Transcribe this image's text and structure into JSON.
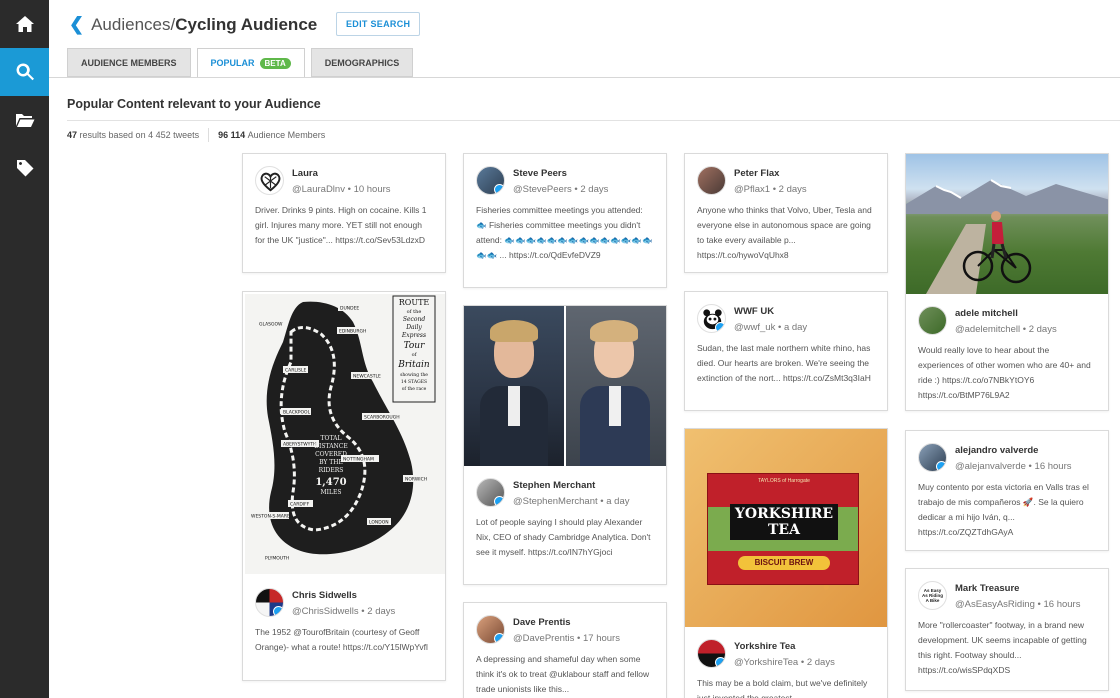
{
  "sidebar": {
    "items": [
      {
        "icon": "home-icon"
      },
      {
        "icon": "search-icon",
        "active": true
      },
      {
        "icon": "folder-icon"
      },
      {
        "icon": "tag-icon"
      }
    ]
  },
  "header": {
    "breadcrumb_parent": "Audiences",
    "breadcrumb_separator": "/",
    "breadcrumb_current": "Cycling Audience",
    "edit_search_label": "EDIT SEARCH"
  },
  "tabs": [
    {
      "label": "AUDIENCE MEMBERS"
    },
    {
      "label": "POPULAR",
      "badge": "BETA",
      "active": true
    },
    {
      "label": "DEMOGRAPHICS"
    }
  ],
  "section": {
    "title": "Popular Content relevant to your Audience",
    "results_count": "47",
    "results_text": "results based on 4 452 tweets",
    "members_count": "96 114",
    "members_text": "Audience Members"
  },
  "cards": {
    "laura": {
      "name": "Laura",
      "handle": "@LauraDlnv",
      "time": "10 hours",
      "text": "Driver. Drinks 9 pints. High on cocaine. Kills 1 girl. Injures many more. YET still not enough for the UK \"justice\"... https://t.co/Sev53LdzxD"
    },
    "steve": {
      "name": "Steve Peers",
      "handle": "@StevePeers",
      "time": "2 days",
      "text": "Fisheries committee meetings you attended: 🐟 Fisheries committee meetings you didn't attend: 🐟🐟🐟🐟🐟🐟🐟🐟🐟🐟🐟🐟🐟🐟🐟🐟 ... https://t.co/QdEvfeDVZ9"
    },
    "peter": {
      "name": "Peter Flax",
      "handle": "@Pflax1",
      "time": "2 days",
      "text": "Anyone who thinks that Volvo, Uber, Tesla and everyone else in autonomous space are going to take every available p... https://t.co/hywoVqUhx8"
    },
    "adele": {
      "name": "adele mitchell",
      "handle": "@adelemitchell",
      "time": "2 days",
      "text": "Would really love to hear about the experiences of other women who are 40+ and ride :) https://t.co/o7NBkYtOY6 https://t.co/BtMP76L9A2"
    },
    "wwf": {
      "name": "WWF UK",
      "handle": "@wwf_uk",
      "time": "a day",
      "text": "Sudan, the last male northern white rhino, has died. Our hearts are broken. We're seeing the extinction of the nort... https://t.co/ZsMt3q3IaH"
    },
    "stephen": {
      "name": "Stephen Merchant",
      "handle": "@StephenMerchant",
      "time": "a day",
      "text": "Lot of people saying I should play Alexander Nix, CEO of shady Cambridge Analytica. Don't see it myself. https://t.co/IN7hYGjoci"
    },
    "chris": {
      "name": "Chris Sidwells",
      "handle": "@ChrisSidwells",
      "time": "2 days",
      "text": "The 1952 @TourofBritain (courtesy of Geoff Orange)- what a route! https://t.co/Y15lWpYvfl"
    },
    "alejandro": {
      "name": "alejandro valverde",
      "handle": "@alejanvalverde",
      "time": "16 hours",
      "text": "Muy contento por esta victoria en Valls tras el trabajo de mis compañeros 🚀. Se la quiero dedicar a mi hijo Iván, q... https://t.co/ZQZTdhGAyA"
    },
    "yorkshire": {
      "name": "Yorkshire Tea",
      "handle": "@YorkshireTea",
      "time": "2 days",
      "text": "This may be a bold claim, but we've definitely just invented the greatest..."
    },
    "dave": {
      "name": "Dave Prentis",
      "handle": "@DavePrentis",
      "time": "17 hours",
      "text": "A depressing and shameful day when some think it's ok to treat @uklabour staff and fellow trade unionists like this..."
    },
    "mark": {
      "name": "Mark Treasure",
      "handle": "@AsEasyAsRiding",
      "time": "16 hours",
      "text": "More \"rollercoaster\" footway, in a brand new development. UK seems incapable of getting this right. Footway should... https://t.co/wisSPdqXDS"
    }
  },
  "map_text": {
    "title_lines": [
      "ROUTE",
      "of the",
      "Second",
      "Daily",
      "Express",
      "Tour",
      "of",
      "Britain",
      "showing the",
      "14 STAGES",
      "of the race"
    ],
    "towns": [
      "DUNDEE",
      "GLASGOW",
      "EDINBURGH",
      "CARLISLE",
      "NEWCASTLE",
      "BLACKPOOL",
      "SCARBOROUGH",
      "ABERYSTWYTH",
      "NOTTINGHAM",
      "NORWICH",
      "CARDIFF",
      "LONDON",
      "WESTON-S-MARE",
      "PLYMOUTH"
    ],
    "distance_lines": [
      "TOTAL",
      "DISTANCE",
      "COVERED",
      "BY THE",
      "RIDERS",
      "1,470",
      "MILES"
    ]
  },
  "product_text": {
    "brand_top": "TAYLORS of Harrogate",
    "brand": "YORKSHIRE",
    "brand2": "TEA",
    "ribbon": "BISCUIT BREW"
  },
  "avatar_text": {
    "mark": "As Easy As Riding A Bike"
  },
  "colors": {
    "accent": "#1b8fd6",
    "sidebar": "#2b2b2b",
    "beta": "#5fb84a",
    "verified": "#1da1f2"
  }
}
